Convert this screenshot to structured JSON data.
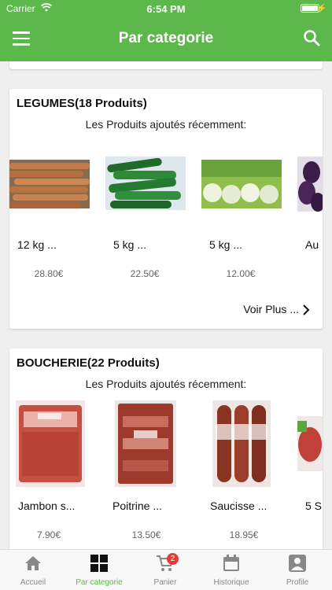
{
  "status_bar": {
    "carrier": "Carrier",
    "time": "6:54 PM"
  },
  "app_bar": {
    "title": "Par categorie"
  },
  "categories": [
    {
      "title": "LEGUMES(18 Produits)",
      "subtitle": "Les Produits ajoutés récemment:",
      "products": [
        {
          "name": "12 kg ...",
          "price": "28.80€",
          "image": "carrots"
        },
        {
          "name": "5 kg ...",
          "price": "22.50€",
          "image": "zucchini"
        },
        {
          "name": "5 kg ...",
          "price": "12.00€",
          "image": "turnips"
        },
        {
          "name": "Au",
          "price": "",
          "image": "eggplant"
        }
      ],
      "see_more": "Voir Plus ..."
    },
    {
      "title": "BOUCHERIE(22 Produits)",
      "subtitle": "Les Produits ajoutés récemment:",
      "products": [
        {
          "name": "Jambon s...",
          "price": "7.90€",
          "image": "ham"
        },
        {
          "name": "Poitrine ...",
          "price": "13.50€",
          "image": "pork-belly"
        },
        {
          "name": "Saucisse ...",
          "price": "18.95€",
          "image": "sausage"
        },
        {
          "name": "5 S",
          "price": "",
          "image": "meat"
        }
      ]
    }
  ],
  "tab_bar": {
    "tabs": [
      {
        "label": "Accueil",
        "icon": "home-icon"
      },
      {
        "label": "Par categorie",
        "icon": "grid-icon",
        "active": true
      },
      {
        "label": "Panier",
        "icon": "cart-icon",
        "badge": "2"
      },
      {
        "label": "Historique",
        "icon": "calendar-icon"
      },
      {
        "label": "Profile",
        "icon": "profile-icon"
      }
    ]
  },
  "colors": {
    "primary": "#5cb84a",
    "badge": "#e53935"
  }
}
